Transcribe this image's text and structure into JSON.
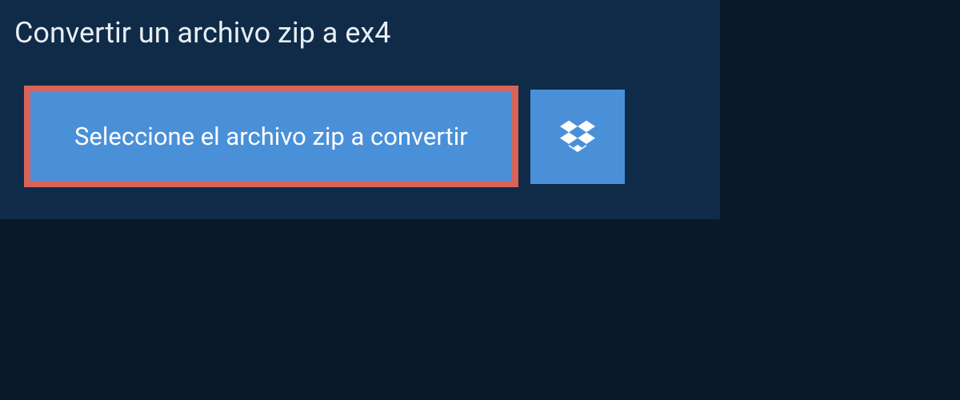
{
  "header": {
    "title": "Convertir un archivo zip a ex4"
  },
  "buttons": {
    "select_file_label": "Seleccione el archivo zip a convertir"
  },
  "colors": {
    "background": "#0a1929",
    "panel": "#0f2b47",
    "button_primary": "#4a90d9",
    "highlight_border": "#d96358",
    "text_light": "#e8eef4"
  },
  "icons": {
    "dropbox": "dropbox-icon"
  }
}
